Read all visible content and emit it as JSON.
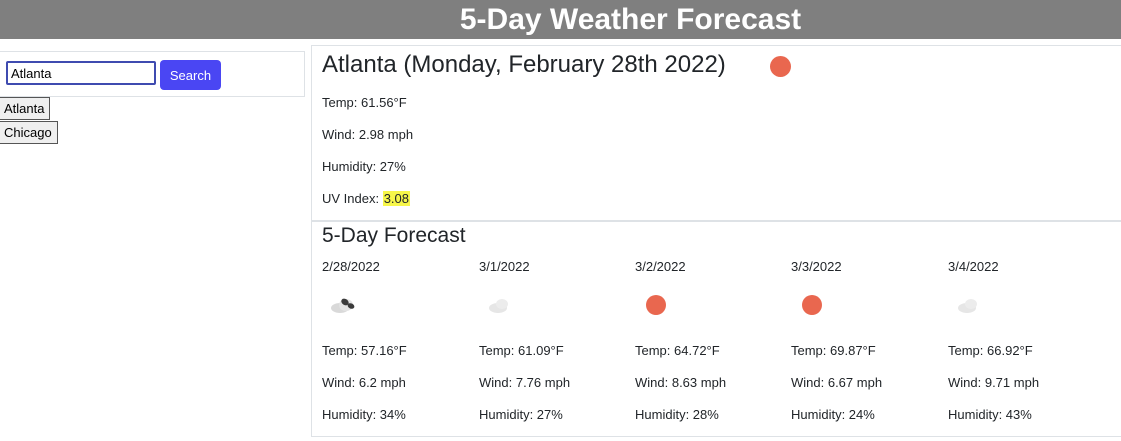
{
  "header": {
    "title": "5-Day Weather Forecast"
  },
  "search": {
    "value": "Atlanta",
    "button_label": "Search"
  },
  "history": [
    "Atlanta",
    "Chicago"
  ],
  "current": {
    "title": "Atlanta (Monday, February 28th 2022)",
    "icon": "clear-sun-icon",
    "temp": "Temp: 61.56°F",
    "wind": "Wind: 2.98 mph",
    "humidity": "Humidity: 27%",
    "uv_label": "UV Index: ",
    "uv_value": "3.08"
  },
  "forecast": {
    "title": "5-Day Forecast",
    "days": [
      {
        "date": "2/28/2022",
        "icon": "broken-clouds-icon",
        "temp": "Temp: 57.16°F",
        "wind": "Wind: 6.2 mph",
        "humidity": "Humidity: 34%"
      },
      {
        "date": "3/1/2022",
        "icon": "few-clouds-icon",
        "temp": "Temp: 61.09°F",
        "wind": "Wind: 7.76 mph",
        "humidity": "Humidity: 27%"
      },
      {
        "date": "3/2/2022",
        "icon": "clear-sun-icon",
        "temp": "Temp: 64.72°F",
        "wind": "Wind: 8.63 mph",
        "humidity": "Humidity: 28%"
      },
      {
        "date": "3/3/2022",
        "icon": "clear-sun-icon",
        "temp": "Temp: 69.87°F",
        "wind": "Wind: 6.67 mph",
        "humidity": "Humidity: 24%"
      },
      {
        "date": "3/4/2022",
        "icon": "few-clouds-icon",
        "temp": "Temp: 66.92°F",
        "wind": "Wind: 9.71 mph",
        "humidity": "Humidity: 43%"
      }
    ]
  },
  "colors": {
    "header_bg": "#7f7f7f",
    "search_button": "#4a46f3",
    "sun": "#e9674f",
    "uv_highlight": "#f7f74a"
  }
}
